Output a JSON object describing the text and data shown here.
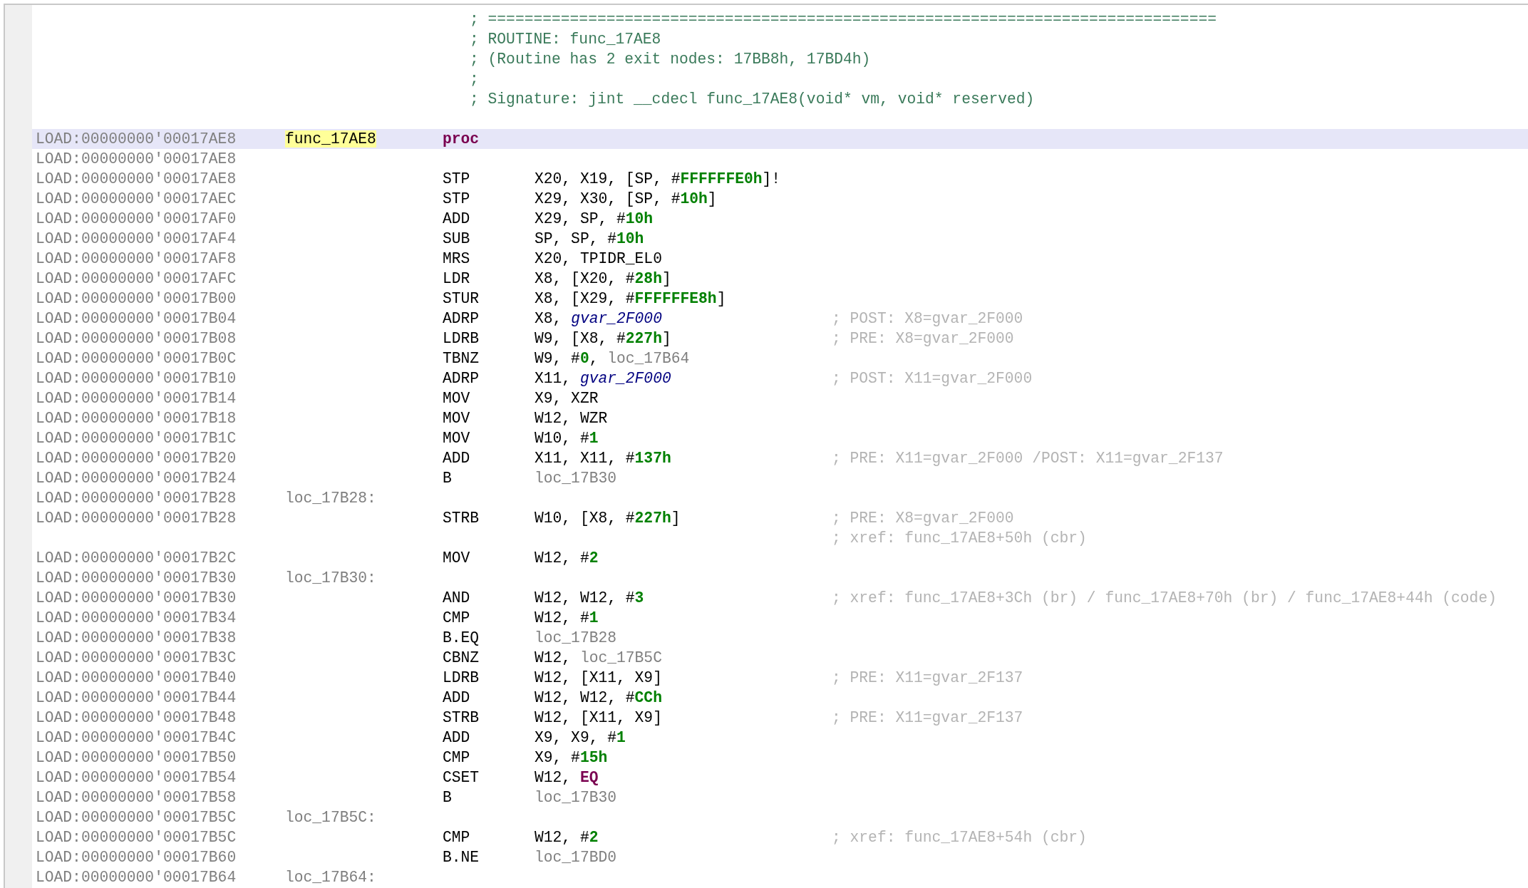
{
  "header_comments": [
    "; ================================================================================",
    "; ROUTINE: func_17AE8",
    "; (Routine has 2 exit nodes: 17BB8h, 17BD4h)",
    ";",
    "; Signature: jint __cdecl func_17AE8(void* vm, void* reserved)"
  ],
  "rows": [
    {
      "address": "LOAD:00000000'00017AE8",
      "selected": true,
      "label": {
        "text": "func_17AE8",
        "highlighted": true
      },
      "mnemonic": {
        "text": "proc",
        "kind": "directive"
      }
    },
    {
      "address": "LOAD:00000000'00017AE8",
      "selected": false
    },
    {
      "address": "LOAD:00000000'00017AE8",
      "selected": false,
      "mnemonic": {
        "text": "STP",
        "kind": "instruction"
      },
      "operands": [
        {
          "kind": "plain",
          "text": "X20, X19, [SP, #"
        },
        {
          "kind": "number",
          "text": "FFFFFFE0h"
        },
        {
          "kind": "plain",
          "text": "]!"
        }
      ]
    },
    {
      "address": "LOAD:00000000'00017AEC",
      "selected": false,
      "mnemonic": {
        "text": "STP",
        "kind": "instruction"
      },
      "operands": [
        {
          "kind": "plain",
          "text": "X29, X30, [SP, #"
        },
        {
          "kind": "number",
          "text": "10h"
        },
        {
          "kind": "plain",
          "text": "]"
        }
      ]
    },
    {
      "address": "LOAD:00000000'00017AF0",
      "selected": false,
      "mnemonic": {
        "text": "ADD",
        "kind": "instruction"
      },
      "operands": [
        {
          "kind": "plain",
          "text": "X29, SP, #"
        },
        {
          "kind": "number",
          "text": "10h"
        }
      ]
    },
    {
      "address": "LOAD:00000000'00017AF4",
      "selected": false,
      "mnemonic": {
        "text": "SUB",
        "kind": "instruction"
      },
      "operands": [
        {
          "kind": "plain",
          "text": "SP, SP, #"
        },
        {
          "kind": "number",
          "text": "10h"
        }
      ]
    },
    {
      "address": "LOAD:00000000'00017AF8",
      "selected": false,
      "mnemonic": {
        "text": "MRS",
        "kind": "instruction"
      },
      "operands": [
        {
          "kind": "plain",
          "text": "X20, TPIDR_EL0"
        }
      ]
    },
    {
      "address": "LOAD:00000000'00017AFC",
      "selected": false,
      "mnemonic": {
        "text": "LDR",
        "kind": "instruction"
      },
      "operands": [
        {
          "kind": "plain",
          "text": "X8, [X20, #"
        },
        {
          "kind": "number",
          "text": "28h"
        },
        {
          "kind": "plain",
          "text": "]"
        }
      ]
    },
    {
      "address": "LOAD:00000000'00017B00",
      "selected": false,
      "mnemonic": {
        "text": "STUR",
        "kind": "instruction"
      },
      "operands": [
        {
          "kind": "plain",
          "text": "X8, [X29, #"
        },
        {
          "kind": "number",
          "text": "FFFFFFE8h"
        },
        {
          "kind": "plain",
          "text": "]"
        }
      ]
    },
    {
      "address": "LOAD:00000000'00017B04",
      "selected": false,
      "mnemonic": {
        "text": "ADRP",
        "kind": "instruction"
      },
      "operands": [
        {
          "kind": "plain",
          "text": "X8, "
        },
        {
          "kind": "name",
          "text": "gvar_2F000"
        }
      ],
      "comments": [
        "; POST: X8=gvar_2F000"
      ]
    },
    {
      "address": "LOAD:00000000'00017B08",
      "selected": false,
      "mnemonic": {
        "text": "LDRB",
        "kind": "instruction"
      },
      "operands": [
        {
          "kind": "plain",
          "text": "W9, [X8, #"
        },
        {
          "kind": "number",
          "text": "227h"
        },
        {
          "kind": "plain",
          "text": "]"
        }
      ],
      "comments": [
        "; PRE: X8=gvar_2F000"
      ]
    },
    {
      "address": "LOAD:00000000'00017B0C",
      "selected": false,
      "mnemonic": {
        "text": "TBNZ",
        "kind": "instruction"
      },
      "operands": [
        {
          "kind": "plain",
          "text": "W9, #"
        },
        {
          "kind": "number",
          "text": "0"
        },
        {
          "kind": "plain",
          "text": ", "
        },
        {
          "kind": "loc",
          "text": "loc_17B64"
        }
      ]
    },
    {
      "address": "LOAD:00000000'00017B10",
      "selected": false,
      "mnemonic": {
        "text": "ADRP",
        "kind": "instruction"
      },
      "operands": [
        {
          "kind": "plain",
          "text": "X11, "
        },
        {
          "kind": "name",
          "text": "gvar_2F000"
        }
      ],
      "comments": [
        "; POST: X11=gvar_2F000"
      ]
    },
    {
      "address": "LOAD:00000000'00017B14",
      "selected": false,
      "mnemonic": {
        "text": "MOV",
        "kind": "instruction"
      },
      "operands": [
        {
          "kind": "plain",
          "text": "X9, XZR"
        }
      ]
    },
    {
      "address": "LOAD:00000000'00017B18",
      "selected": false,
      "mnemonic": {
        "text": "MOV",
        "kind": "instruction"
      },
      "operands": [
        {
          "kind": "plain",
          "text": "W12, WZR"
        }
      ]
    },
    {
      "address": "LOAD:00000000'00017B1C",
      "selected": false,
      "mnemonic": {
        "text": "MOV",
        "kind": "instruction"
      },
      "operands": [
        {
          "kind": "plain",
          "text": "W10, #"
        },
        {
          "kind": "number",
          "text": "1"
        }
      ]
    },
    {
      "address": "LOAD:00000000'00017B20",
      "selected": false,
      "mnemonic": {
        "text": "ADD",
        "kind": "instruction"
      },
      "operands": [
        {
          "kind": "plain",
          "text": "X11, X11, #"
        },
        {
          "kind": "number",
          "text": "137h"
        }
      ],
      "comments": [
        "; PRE: X11=gvar_2F000 /POST: X11=gvar_2F137"
      ]
    },
    {
      "address": "LOAD:00000000'00017B24",
      "selected": false,
      "mnemonic": {
        "text": "B",
        "kind": "instruction"
      },
      "operands": [
        {
          "kind": "loc",
          "text": "loc_17B30"
        }
      ]
    },
    {
      "address": "LOAD:00000000'00017B28",
      "selected": false,
      "label": {
        "text": "loc_17B28:",
        "highlighted": false
      }
    },
    {
      "address": "LOAD:00000000'00017B28",
      "selected": false,
      "mnemonic": {
        "text": "STRB",
        "kind": "instruction"
      },
      "operands": [
        {
          "kind": "plain",
          "text": "W10, [X8, #"
        },
        {
          "kind": "number",
          "text": "227h"
        },
        {
          "kind": "plain",
          "text": "]"
        }
      ],
      "comments": [
        "; PRE: X8=gvar_2F000",
        "; xref: func_17AE8+50h (cbr)"
      ]
    },
    {
      "address": "LOAD:00000000'00017B2C",
      "selected": false,
      "mnemonic": {
        "text": "MOV",
        "kind": "instruction"
      },
      "operands": [
        {
          "kind": "plain",
          "text": "W12, #"
        },
        {
          "kind": "number",
          "text": "2"
        }
      ]
    },
    {
      "address": "LOAD:00000000'00017B30",
      "selected": false,
      "label": {
        "text": "loc_17B30:",
        "highlighted": false
      }
    },
    {
      "address": "LOAD:00000000'00017B30",
      "selected": false,
      "mnemonic": {
        "text": "AND",
        "kind": "instruction"
      },
      "operands": [
        {
          "kind": "plain",
          "text": "W12, W12, #"
        },
        {
          "kind": "number",
          "text": "3"
        }
      ],
      "comments": [
        "; xref: func_17AE8+3Ch (br) / func_17AE8+70h (br) / func_17AE8+44h (code)"
      ]
    },
    {
      "address": "LOAD:00000000'00017B34",
      "selected": false,
      "mnemonic": {
        "text": "CMP",
        "kind": "instruction"
      },
      "operands": [
        {
          "kind": "plain",
          "text": "W12, #"
        },
        {
          "kind": "number",
          "text": "1"
        }
      ]
    },
    {
      "address": "LOAD:00000000'00017B38",
      "selected": false,
      "mnemonic": {
        "text": "B.EQ",
        "kind": "instruction"
      },
      "operands": [
        {
          "kind": "loc",
          "text": "loc_17B28"
        }
      ]
    },
    {
      "address": "LOAD:00000000'00017B3C",
      "selected": false,
      "mnemonic": {
        "text": "CBNZ",
        "kind": "instruction"
      },
      "operands": [
        {
          "kind": "plain",
          "text": "W12, "
        },
        {
          "kind": "loc",
          "text": "loc_17B5C"
        }
      ]
    },
    {
      "address": "LOAD:00000000'00017B40",
      "selected": false,
      "mnemonic": {
        "text": "LDRB",
        "kind": "instruction"
      },
      "operands": [
        {
          "kind": "plain",
          "text": "W12, [X11, X9]"
        }
      ],
      "comments": [
        "; PRE: X11=gvar_2F137"
      ]
    },
    {
      "address": "LOAD:00000000'00017B44",
      "selected": false,
      "mnemonic": {
        "text": "ADD",
        "kind": "instruction"
      },
      "operands": [
        {
          "kind": "plain",
          "text": "W12, W12, #"
        },
        {
          "kind": "number",
          "text": "CCh"
        }
      ]
    },
    {
      "address": "LOAD:00000000'00017B48",
      "selected": false,
      "mnemonic": {
        "text": "STRB",
        "kind": "instruction"
      },
      "operands": [
        {
          "kind": "plain",
          "text": "W12, [X11, X9]"
        }
      ],
      "comments": [
        "; PRE: X11=gvar_2F137"
      ]
    },
    {
      "address": "LOAD:00000000'00017B4C",
      "selected": false,
      "mnemonic": {
        "text": "ADD",
        "kind": "instruction"
      },
      "operands": [
        {
          "kind": "plain",
          "text": "X9, X9, #"
        },
        {
          "kind": "number",
          "text": "1"
        }
      ]
    },
    {
      "address": "LOAD:00000000'00017B50",
      "selected": false,
      "mnemonic": {
        "text": "CMP",
        "kind": "instruction"
      },
      "operands": [
        {
          "kind": "plain",
          "text": "X9, #"
        },
        {
          "kind": "number",
          "text": "15h"
        }
      ]
    },
    {
      "address": "LOAD:00000000'00017B54",
      "selected": false,
      "mnemonic": {
        "text": "CSET",
        "kind": "instruction"
      },
      "operands": [
        {
          "kind": "plain",
          "text": "W12, "
        },
        {
          "kind": "keyword",
          "text": "EQ"
        }
      ]
    },
    {
      "address": "LOAD:00000000'00017B58",
      "selected": false,
      "mnemonic": {
        "text": "B",
        "kind": "instruction"
      },
      "operands": [
        {
          "kind": "loc",
          "text": "loc_17B30"
        }
      ]
    },
    {
      "address": "LOAD:00000000'00017B5C",
      "selected": false,
      "label": {
        "text": "loc_17B5C:",
        "highlighted": false
      }
    },
    {
      "address": "LOAD:00000000'00017B5C",
      "selected": false,
      "mnemonic": {
        "text": "CMP",
        "kind": "instruction"
      },
      "operands": [
        {
          "kind": "plain",
          "text": "W12, #"
        },
        {
          "kind": "number",
          "text": "2"
        }
      ],
      "comments": [
        "; xref: func_17AE8+54h (cbr)"
      ]
    },
    {
      "address": "LOAD:00000000'00017B60",
      "selected": false,
      "mnemonic": {
        "text": "B.NE",
        "kind": "instruction"
      },
      "operands": [
        {
          "kind": "loc",
          "text": "loc_17BD0"
        }
      ]
    },
    {
      "address": "LOAD:00000000'00017B64",
      "selected": false,
      "label": {
        "text": "loc_17B64:",
        "highlighted": false
      }
    }
  ]
}
